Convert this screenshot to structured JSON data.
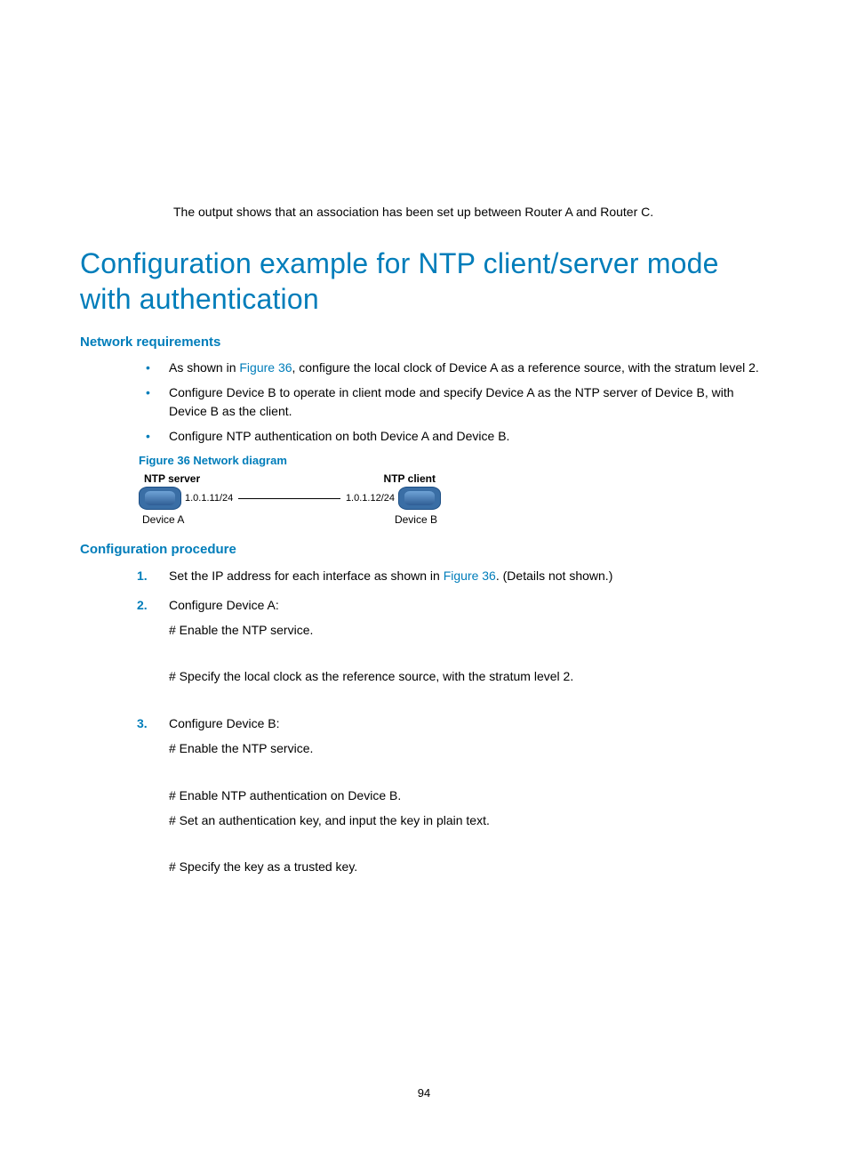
{
  "intro": "The output shows that an association has been set up between Router A and Router C.",
  "heading": "Configuration example for NTP client/server mode with authentication",
  "sub1": "Network requirements",
  "bullets": [
    {
      "pre": "As shown in ",
      "link": "Figure 36",
      "post": ", configure the local clock of Device A as a reference source, with the stratum level 2."
    },
    {
      "text": "Configure Device B to operate in client mode and specify Device A as the NTP server of Device B, with Device B as the client."
    },
    {
      "text": "Configure NTP authentication on both Device A and Device B."
    }
  ],
  "figcap": "Figure 36 Network diagram",
  "diagram": {
    "left_role": "NTP server",
    "right_role": "NTP client",
    "left_ip": "1.0.1.11/24",
    "right_ip": "1.0.1.12/24",
    "left_name": "Device A",
    "right_name": "Device B"
  },
  "sub2": "Configuration procedure",
  "steps": [
    {
      "main_pre": "Set the IP address for each interface as shown in ",
      "main_link": "Figure 36",
      "main_post": ". (Details not shown.)",
      "subs": []
    },
    {
      "main": "Configure Device A:",
      "subs": [
        "# Enable the NTP service.",
        "# Specify the local clock as the reference source, with the stratum level 2."
      ]
    },
    {
      "main": "Configure Device B:",
      "subs": [
        "# Enable the NTP service.",
        "# Enable NTP authentication on Device B.",
        "# Set an authentication key, and input the key in plain text.",
        "# Specify the key as a trusted key."
      ]
    }
  ],
  "page_number": "94"
}
